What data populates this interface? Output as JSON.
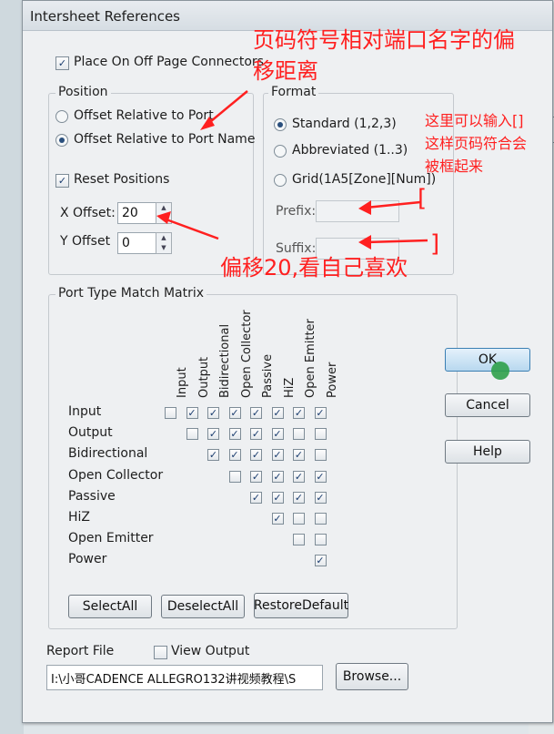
{
  "dialog": {
    "title": "Intersheet References",
    "place_connectors": {
      "label": "Place On Off Page Connectors",
      "checked": true
    },
    "position": {
      "label": "Position",
      "offset_port": {
        "label": "Offset Relative to Port",
        "selected": false
      },
      "offset_port_name": {
        "label": "Offset Relative to Port Name",
        "selected": true
      },
      "reset": {
        "label": "Reset Positions",
        "checked": true
      },
      "x_offset": {
        "label": "X Offset:",
        "value": "20"
      },
      "y_offset": {
        "label": "Y Offset",
        "value": "0"
      }
    },
    "format": {
      "label": "Format",
      "standard": {
        "label": "Standard (1,2,3)",
        "selected": true
      },
      "abbreviated": {
        "label": "Abbreviated (1..3)",
        "selected": false
      },
      "grid": {
        "label": "Grid(1A5[Zone][Num])",
        "selected": false
      },
      "prefix": {
        "label": "Prefix:",
        "value": ""
      },
      "suffix": {
        "label": "Suffix:",
        "value": ""
      }
    },
    "matrix": {
      "label": "Port Type Match Matrix",
      "columns": [
        "Input",
        "Output",
        "Bidirectional",
        "Open Collector",
        "Passive",
        "HiZ",
        "Open Emitter",
        "Power"
      ],
      "rows": [
        {
          "label": "Input",
          "cells": [
            false,
            true,
            true,
            true,
            true,
            true,
            true,
            true
          ]
        },
        {
          "label": "Output",
          "cells": [
            false,
            true,
            true,
            true,
            true,
            false,
            false
          ]
        },
        {
          "label": "Bidirectional",
          "cells": [
            true,
            true,
            true,
            true,
            true,
            false
          ]
        },
        {
          "label": "Open Collector",
          "cells": [
            false,
            true,
            true,
            true,
            true
          ]
        },
        {
          "label": "Passive",
          "cells": [
            true,
            true,
            true,
            true
          ]
        },
        {
          "label": "HiZ",
          "cells": [
            true,
            false,
            false
          ]
        },
        {
          "label": "Open Emitter",
          "cells": [
            false,
            false
          ]
        },
        {
          "label": "Power",
          "cells": [
            true
          ]
        }
      ],
      "select_all": "SelectAll",
      "deselect_all": "DeselectAll",
      "restore_default": "RestoreDefault"
    },
    "buttons": {
      "ok": "OK",
      "cancel": "Cancel",
      "help": "Help"
    },
    "report": {
      "label": "Report File",
      "view_output": {
        "label": "View Output",
        "checked": false
      },
      "path": "I:\\小哥CADENCE ALLEGRO132讲视频教程\\S",
      "browse": "Browse..."
    }
  },
  "annotations": {
    "port_name_note_line1": "页码符号相对端口名字的偏",
    "port_name_note_line2": "移距离",
    "offset_note": "偏移20,看自己喜欢",
    "prefix_note_line1": "这里可以输入[]",
    "prefix_note_line2": "这样页码符合会",
    "prefix_note_line3": "被框起来",
    "bracket_open": "[",
    "bracket_close": "]",
    "color": "#ff2020"
  },
  "check_mark": "✓"
}
